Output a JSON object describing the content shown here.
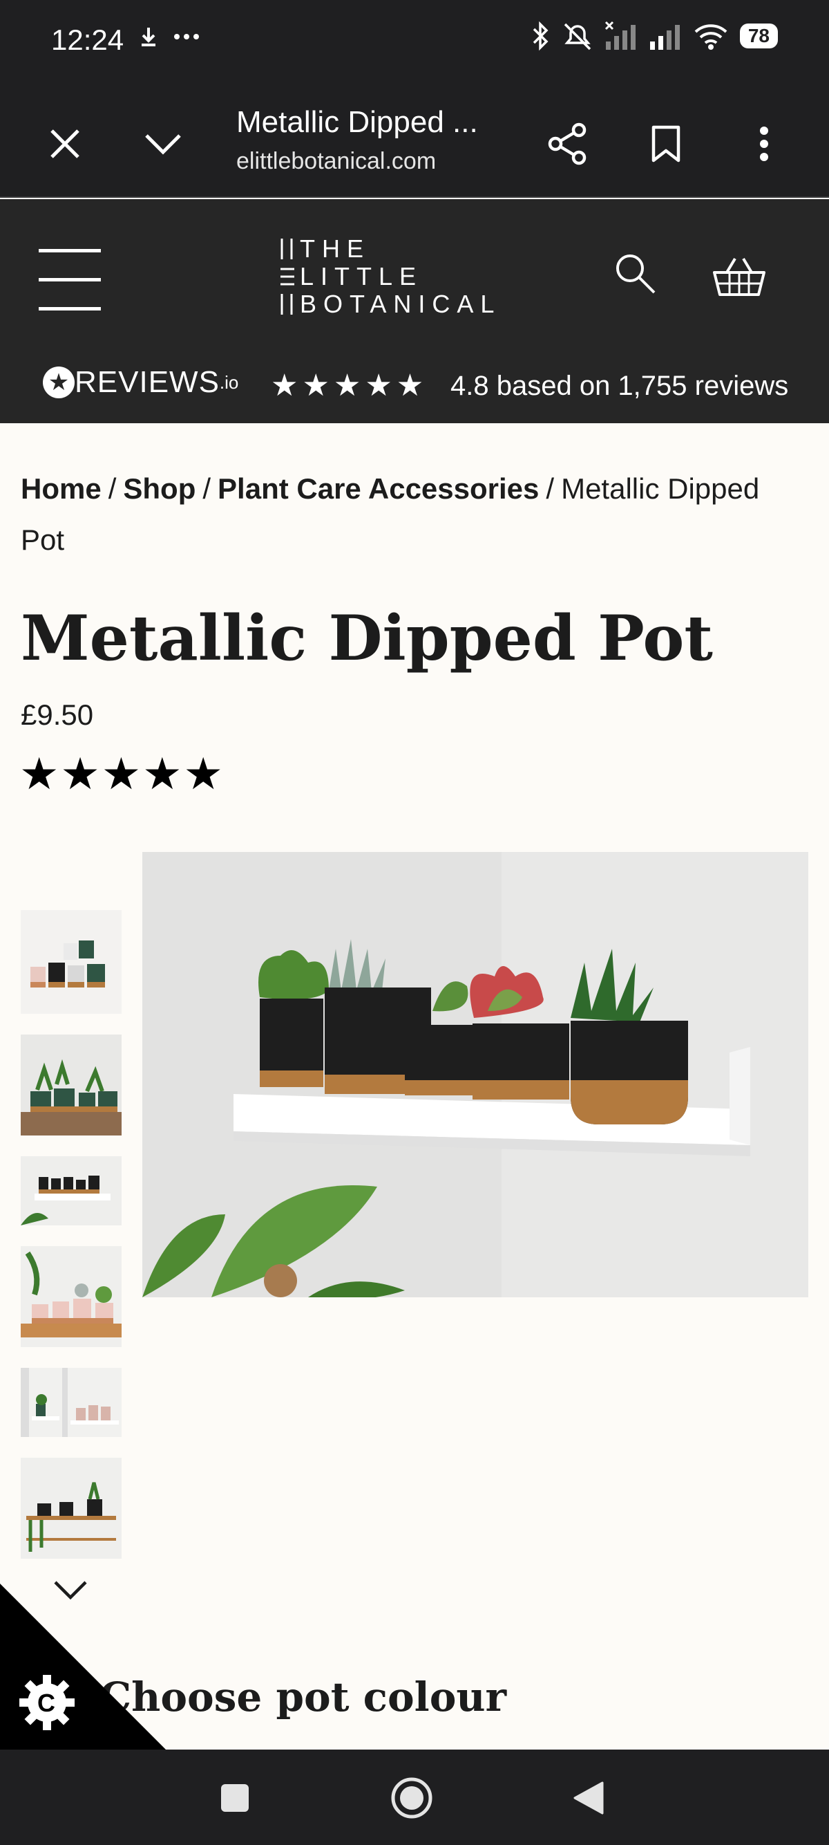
{
  "status_bar": {
    "time": "12:24",
    "battery": "78",
    "icons": [
      "download-icon",
      "more-icon",
      "bluetooth-icon",
      "mute-icon",
      "signal-icon",
      "wifi-icon",
      "battery-icon"
    ]
  },
  "browser": {
    "title": "Metallic Dipped ...",
    "url": "elittlebotanical.com"
  },
  "site": {
    "logo_lines": [
      "THE",
      "LITTLE",
      "BOTANICAL"
    ],
    "reviews_brand": "REVIEWS",
    "reviews_brand_suffix": ".io",
    "reviews_stars": "★★★★★",
    "reviews_summary": "4.8 based on 1,755 reviews"
  },
  "breadcrumb": {
    "items": [
      {
        "label": "Home"
      },
      {
        "label": "Shop"
      },
      {
        "label": "Plant Care Accessories"
      }
    ],
    "separator": "/",
    "current": "Metallic Dipped Pot"
  },
  "product": {
    "title": "Metallic Dipped Pot",
    "price": "£9.50",
    "rating_stars": "★★★★★",
    "rating": 5,
    "section_heading": "Choose pot colour"
  },
  "gallery": {
    "thumbnail_count": 6
  },
  "cookie": {
    "badge_letter": "C"
  },
  "colors": {
    "header_bg": "#262626",
    "page_bg": "#fdfbf7",
    "system_bar": "#1f1f21",
    "pot_black": "#1e1e1e",
    "pot_copper": "#b37a3e"
  }
}
